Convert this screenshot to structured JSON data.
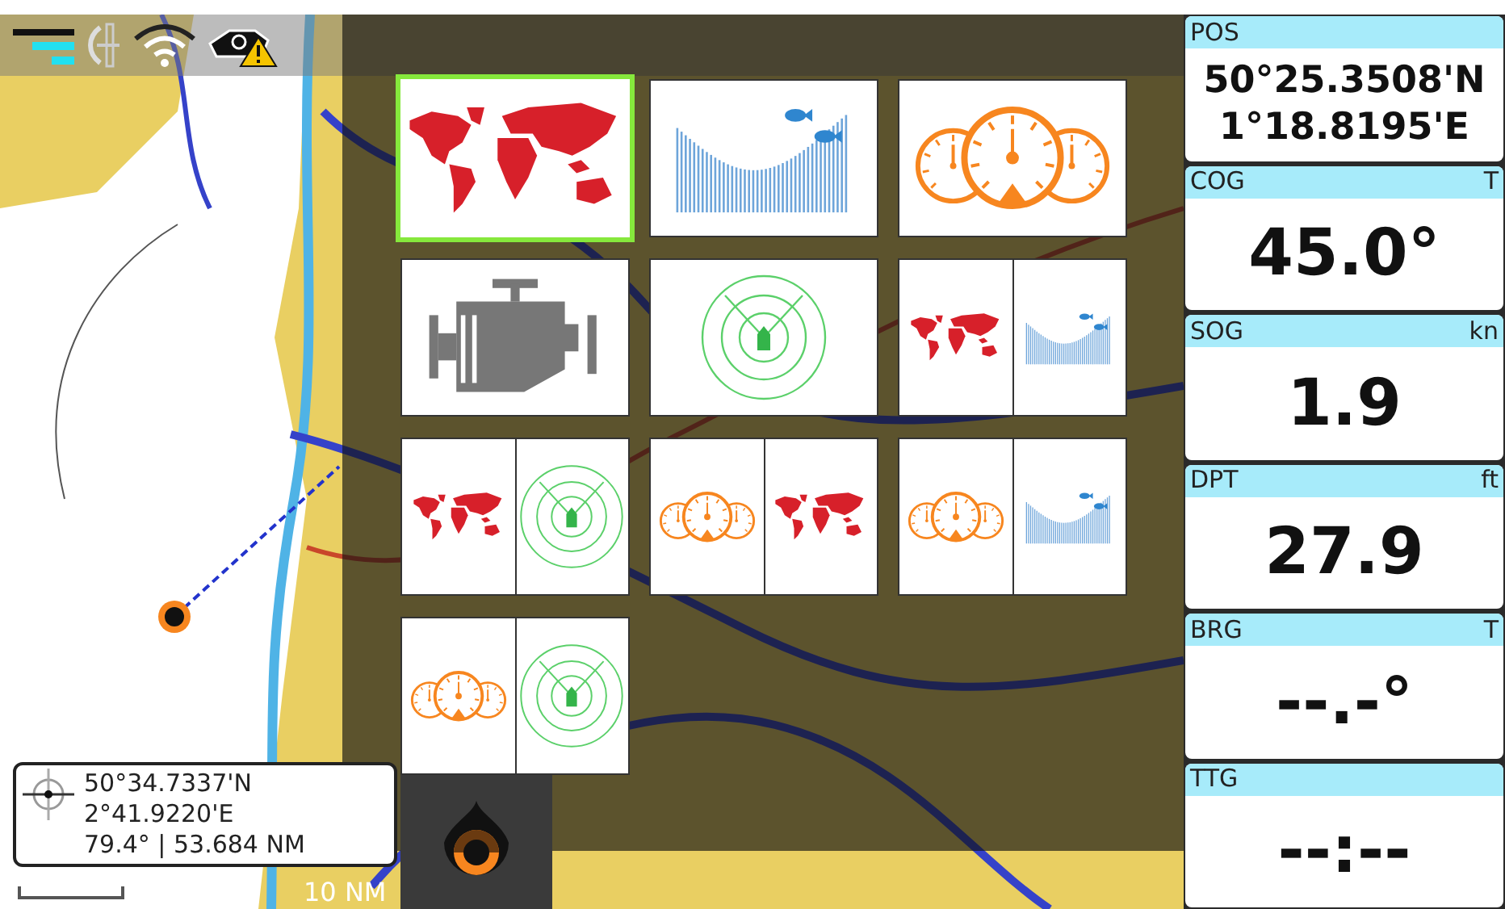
{
  "view_tiles": [
    {
      "selected": true,
      "panes": [
        {
          "kind": "chart"
        }
      ]
    },
    {
      "selected": false,
      "panes": [
        {
          "kind": "sonar"
        }
      ]
    },
    {
      "selected": false,
      "panes": [
        {
          "kind": "gauges"
        }
      ]
    },
    {
      "selected": false,
      "panes": [
        {
          "kind": "engine"
        }
      ]
    },
    {
      "selected": false,
      "panes": [
        {
          "kind": "radar"
        }
      ]
    },
    {
      "selected": false,
      "panes": [
        {
          "kind": "chart"
        },
        {
          "kind": "sonar"
        }
      ]
    },
    {
      "selected": false,
      "panes": [
        {
          "kind": "chart"
        },
        {
          "kind": "radar"
        }
      ]
    },
    {
      "selected": false,
      "panes": [
        {
          "kind": "gauges"
        },
        {
          "kind": "chart"
        }
      ]
    },
    {
      "selected": false,
      "panes": [
        {
          "kind": "gauges"
        },
        {
          "kind": "sonar"
        }
      ]
    },
    {
      "selected": false,
      "panes": [
        {
          "kind": "gauges"
        },
        {
          "kind": "radar"
        }
      ]
    }
  ],
  "data_boxes": [
    {
      "label": "POS",
      "values": [
        "50°25.3508'N",
        "1°18.8195'E"
      ]
    },
    {
      "label": "COG",
      "unit": "T",
      "values": [
        "45.0°"
      ]
    },
    {
      "label": "SOG",
      "unit": "kn",
      "values": [
        "1.9"
      ]
    },
    {
      "label": "DPT",
      "unit": "ft",
      "values": [
        "27.9"
      ]
    },
    {
      "label": "BRG",
      "unit": "T",
      "values": [
        "--.-°"
      ]
    },
    {
      "label": "TTG",
      "values": [
        "--:--"
      ]
    }
  ],
  "cursor_position": {
    "latitude": "50°34.7337'N",
    "longitude": "2°41.9220'E",
    "bearing_range": "79.4° | 53.684 NM"
  },
  "scale": {
    "label": "10 NM"
  }
}
